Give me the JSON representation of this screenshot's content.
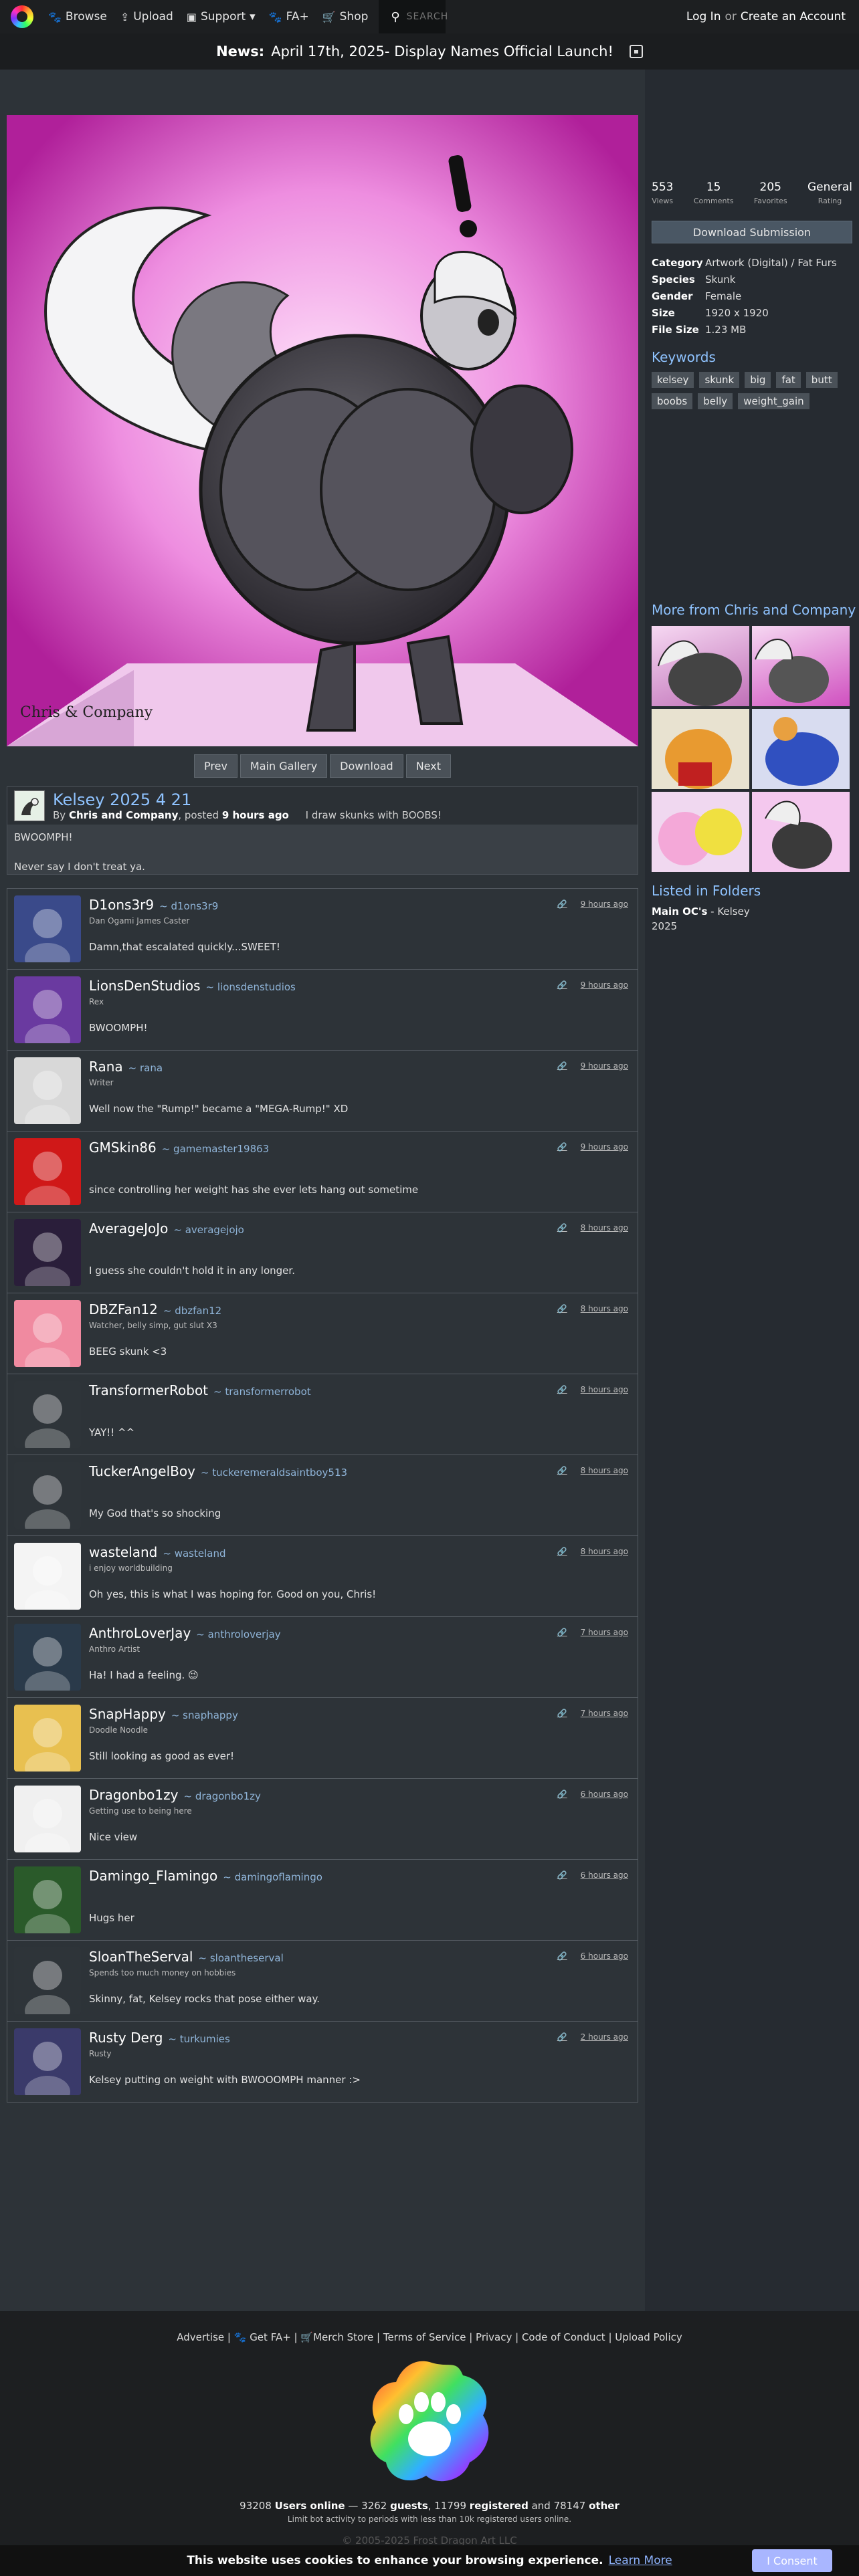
{
  "nav": {
    "browse": "Browse",
    "upload": "Upload",
    "support": "Support",
    "faplus": "FA+",
    "shop": "Shop",
    "search_placeholder": "SEARCH",
    "login": "Log In",
    "or": "or",
    "create": "Create an Account"
  },
  "news": {
    "label": "News:",
    "text": "April 17th, 2025- Display Names Official Launch!"
  },
  "nav_buttons": [
    "Prev",
    "Main Gallery",
    "Download",
    "Next"
  ],
  "submission": {
    "title": "Kelsey 2025 4 21",
    "by": "By",
    "artist": "Chris and Company",
    "posted": ", posted",
    "time": "9 hours ago",
    "tagline": "I draw skunks with BOOBS!",
    "desc1": "BWOOMPH!",
    "desc2": "Never say I don't treat ya.",
    "signature": "Chris & Company"
  },
  "stats": [
    {
      "n": "553",
      "l": "Views"
    },
    {
      "n": "15",
      "l": "Comments"
    },
    {
      "n": "205",
      "l": "Favorites"
    },
    {
      "n": "General",
      "l": "Rating"
    }
  ],
  "download_label": "Download Submission",
  "info": [
    {
      "k": "Category",
      "v": "Artwork (Digital) / Fat Furs"
    },
    {
      "k": "Species",
      "v": "Skunk"
    },
    {
      "k": "Gender",
      "v": "Female"
    },
    {
      "k": "Size",
      "v": "1920 x 1920"
    },
    {
      "k": "File Size",
      "v": "1.23 MB"
    }
  ],
  "keywords_heading": "Keywords",
  "keywords": [
    "kelsey",
    "skunk",
    "big",
    "fat",
    "butt",
    "boobs",
    "belly",
    "weight_gain"
  ],
  "more_from": {
    "label": "More from",
    "artist": "Chris and Company"
  },
  "folders": {
    "heading": "Listed in Folders",
    "name": "Main OC's",
    "sep": " - Kelsey",
    "year": "2025"
  },
  "comments": [
    {
      "name": "D1ons3r9",
      "handle": "~ d1ons3r9",
      "tag": "Dan Ogami James Caster",
      "text": "Damn,that escalated quickly...SWEET!",
      "time": "9 hours ago",
      "color": "#3a4a8a"
    },
    {
      "name": "LionsDenStudios",
      "handle": "~ lionsdenstudios",
      "tag": "Rex",
      "text": "BWOOMPH!",
      "time": "9 hours ago",
      "color": "#6a3aa0"
    },
    {
      "name": "Rana",
      "handle": "~ rana",
      "tag": "Writer",
      "text": "Well now the \"Rump!\" became a \"MEGA-Rump!\" XD",
      "time": "9 hours ago",
      "color": "#d8d8d8"
    },
    {
      "name": "GMSkin86",
      "handle": "~ gamemaster19863",
      "tag": "",
      "text": "since controlling her weight has she ever lets hang out sometime",
      "time": "9 hours ago",
      "color": "#d01818"
    },
    {
      "name": "AverageJoJo",
      "handle": "~ averagejojo",
      "tag": "",
      "text": "I guess she couldn't hold it in any longer.",
      "time": "8 hours ago",
      "color": "#2a1e3a"
    },
    {
      "name": "DBZFan12",
      "handle": "~ dbzfan12",
      "tag": "Watcher, belly simp, gut slut X3",
      "text": "BEEG skunk <3",
      "time": "8 hours ago",
      "color": "#f08aa0"
    },
    {
      "name": "TransformerRobot",
      "handle": "~ transformerrobot",
      "tag": "",
      "text": "YAY!! ^^",
      "time": "8 hours ago",
      "color": "#2e3439"
    },
    {
      "name": "TuckerAngelBoy",
      "handle": "~ tuckeremeraldsaintboy513",
      "tag": "",
      "text": "My God that's so shocking",
      "time": "8 hours ago",
      "color": "#2e3439"
    },
    {
      "name": "wasteland",
      "handle": "~ wasteland",
      "tag": "i enjoy worldbuilding",
      "text": "Oh yes, this is what I was hoping for. Good on you, Chris!",
      "time": "8 hours ago",
      "color": "#f4f4f4"
    },
    {
      "name": "AnthroLoverJay",
      "handle": "~ anthroloverjay",
      "tag": "Anthro Artist",
      "text": "Ha! I had a feeling. 😉",
      "time": "7 hours ago",
      "color": "#2a3a4a"
    },
    {
      "name": "SnapHappy",
      "handle": "~ snaphappy",
      "tag": "Doodle Noodle",
      "text": "Still looking as good as ever!",
      "time": "7 hours ago",
      "color": "#e8c050"
    },
    {
      "name": "Dragonbo1zy",
      "handle": "~ dragonbo1zy",
      "tag": "Getting use to being here",
      "text": "Nice view",
      "time": "6 hours ago",
      "color": "#f0f0f0"
    },
    {
      "name": "Damingo_Flamingo",
      "handle": "~ damingoflamingo",
      "tag": "",
      "text": "Hugs her",
      "time": "6 hours ago",
      "color": "#2a5a2a"
    },
    {
      "name": "SloanTheServal",
      "handle": "~ sloantheserval",
      "tag": "Spends too much money on hobbies",
      "text": "Skinny, fat, Kelsey rocks that pose either way.",
      "time": "6 hours ago",
      "color": "#2e3439"
    },
    {
      "name": "Rusty Derg",
      "handle": "~ turkumies",
      "tag": "Rusty",
      "text": "Kelsey putting on weight with BWOOOMPH manner :>",
      "time": "2 hours ago",
      "color": "#3a3a6a"
    }
  ],
  "footer": {
    "links": [
      "Advertise",
      "Get FA+",
      "Merch Store",
      "Terms of Service",
      "Privacy",
      "Code of Conduct",
      "Upload Policy"
    ],
    "users_online_n": "93208",
    "users_online": "Users online",
    "guests_n": "3262",
    "guests": "guests",
    "registered_n": "11799",
    "registered": "registered",
    "other_n": "78147",
    "other": "other",
    "limit": "Limit bot activity to periods with less than 10k registered users online.",
    "copyright": "© 2005-2025 Frost Dragon Art LLC"
  },
  "cookie": {
    "text": "This website uses cookies to enhance your browsing experience.",
    "learn": "Learn More",
    "consent": "I Consent"
  }
}
